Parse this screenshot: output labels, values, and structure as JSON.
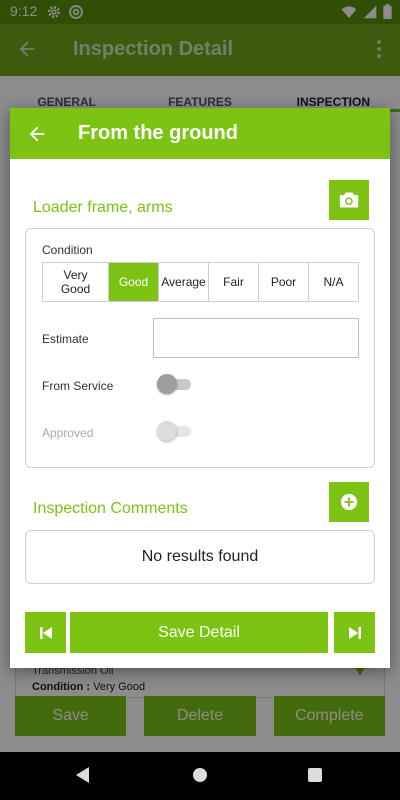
{
  "status_bar": {
    "time": "9:12",
    "icons": [
      "gear-icon",
      "at-icon",
      "wifi-icon",
      "signal-icon",
      "battery-icon"
    ]
  },
  "app_bar": {
    "title": "Inspection Detail",
    "icons": [
      "back-arrow-icon",
      "overflow-menu-icon"
    ]
  },
  "tabs": [
    {
      "label": "GENERAL",
      "active": false
    },
    {
      "label": "FEATURES",
      "active": false
    },
    {
      "label": "INSPECTION",
      "active": true
    }
  ],
  "background_card": {
    "line1": "Transmission Oil",
    "condition_label": "Condition :",
    "condition_value": "Very Good"
  },
  "background_buttons": {
    "save": "Save",
    "delete": "Delete",
    "complete": "Complete"
  },
  "dialog": {
    "title": "From the ground",
    "section_title": "Loader frame, arms",
    "condition": {
      "label": "Condition",
      "options": [
        "Very Good",
        "Good",
        "Average",
        "Fair",
        "Poor",
        "N/A"
      ],
      "selected": "Good"
    },
    "estimate": {
      "label": "Estimate",
      "value": "",
      "placeholder": ""
    },
    "from_service": {
      "label": "From Service",
      "on": false,
      "enabled": true
    },
    "approved": {
      "label": "Approved",
      "on": false,
      "enabled": false
    },
    "comments": {
      "title": "Inspection Comments",
      "empty_text": "No results found"
    },
    "footer": {
      "save_label": "Save Detail"
    }
  },
  "colors": {
    "accent": "#7cc314",
    "app_bar": "#6fa51a",
    "status_bar": "#5a8f0a"
  }
}
